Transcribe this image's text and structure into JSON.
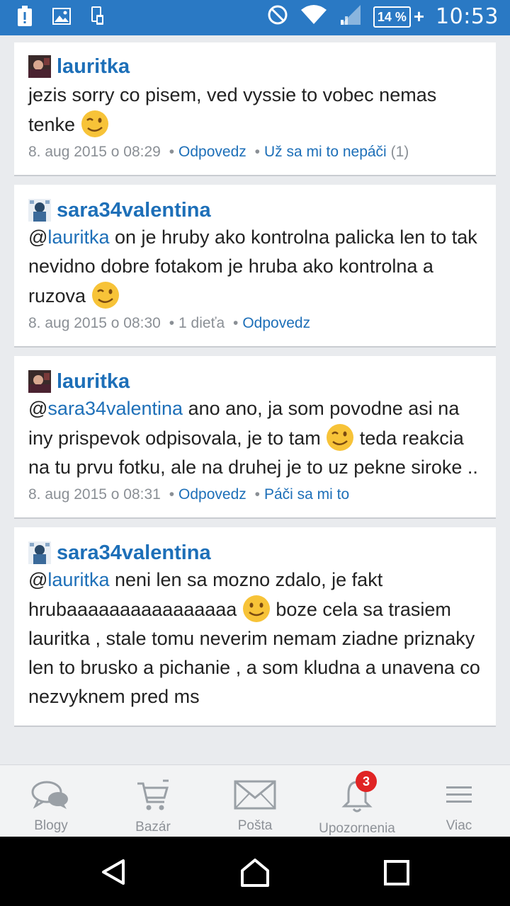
{
  "status_bar": {
    "battery": "14 %",
    "time": "10:53"
  },
  "comments": [
    {
      "user": "lauritka",
      "text_parts": [
        "jezis sorry co pisem, ved vyssie to vobec nemas tenke "
      ],
      "emoji": "wink",
      "date": "8. aug 2015 o 08:29",
      "reply": "Odpovedz",
      "like": "Už sa mi to nepáči",
      "like_count": "(1)"
    },
    {
      "user": "sara34valentina",
      "mention": "lauritka",
      "text_after_mention": " on je hruby ako kontrolna palicka len to tak nevidno dobre fotakom je hruba ako kontrolna a ruzova ",
      "emoji": "wink",
      "date": "8. aug 2015 o 08:30",
      "child": "1 dieťa",
      "reply": "Odpovedz"
    },
    {
      "user": "lauritka",
      "mention": "sara34valentina",
      "text_after_mention": " ano ano, ja som povodne asi na iny prispevok odpisovala, je to tam ",
      "emoji": "wink",
      "text_after_emoji": " teda reakcia na tu prvu fotku, ale na druhej je to uz pekne siroke ..",
      "date": "8. aug 2015 o 08:31",
      "reply": "Odpovedz",
      "like": "Páči sa mi to"
    },
    {
      "user": "sara34valentina",
      "mention": "lauritka",
      "text_after_mention": " neni len sa mozno zdalo, je fakt hrubaaaaaaaaaaaaaaaa ",
      "emoji": "smile",
      "text_after_emoji": " boze cela sa trasiem lauritka , stale tomu neverim nemam ziadne priznaky len to brusko a pichanie , a som kludna a unavena co nezvyknem pred ms"
    }
  ],
  "bottom_nav": [
    {
      "label": "Blogy",
      "icon": "chat-bubbles-icon"
    },
    {
      "label": "Bazár",
      "icon": "cart-icon"
    },
    {
      "label": "Pošta",
      "icon": "envelope-icon"
    },
    {
      "label": "Upozornenia",
      "icon": "bell-icon",
      "badge": "3"
    },
    {
      "label": "Viac",
      "icon": "menu-icon"
    }
  ],
  "colors": {
    "accent": "#1d6fb8",
    "status_bar": "#2a79c4",
    "badge": "#e02424"
  }
}
